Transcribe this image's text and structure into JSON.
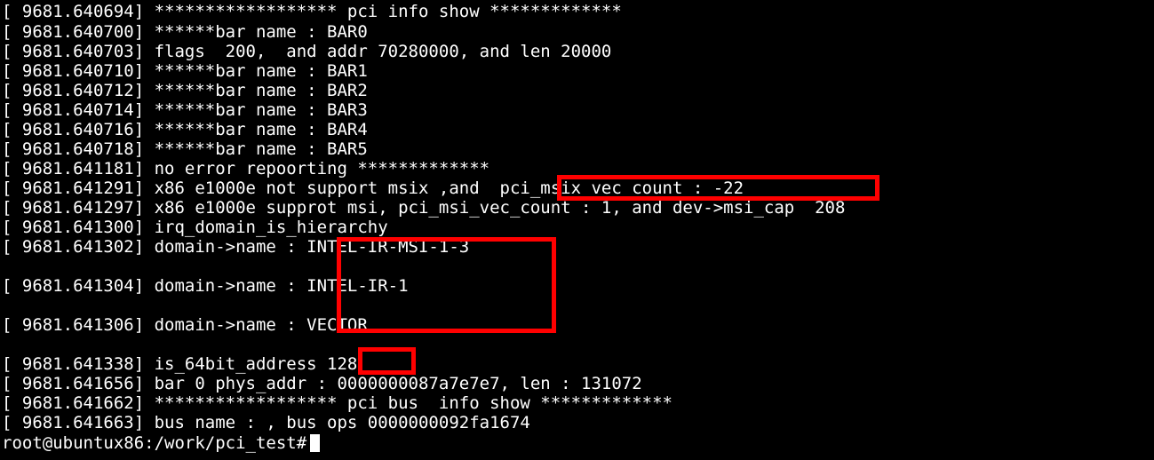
{
  "terminal": {
    "lines": [
      "[ 9681.640694] ****************** pci info show *************",
      "[ 9681.640700] ******bar name : BAR0",
      "[ 9681.640703] flags  200,  and addr 70280000, and len 20000",
      "[ 9681.640710] ******bar name : BAR1",
      "[ 9681.640712] ******bar name : BAR2",
      "[ 9681.640714] ******bar name : BAR3",
      "[ 9681.640716] ******bar name : BAR4",
      "[ 9681.640718] ******bar name : BAR5",
      "[ 9681.641181] no error repoorting *************",
      "[ 9681.641291] x86 e1000e not support msix ,and  pci_msix_vec_count : -22",
      "[ 9681.641297] x86 e1000e supprot msi, pci_msi_vec_count : 1, and dev->msi_cap  208",
      "[ 9681.641300] irq_domain_is_hierarchy",
      "[ 9681.641302] domain->name : INTEL-IR-MSI-1-3",
      "[ 9681.641304] domain->name : INTEL-IR-1",
      "[ 9681.641306] domain->name : VECTOR",
      "[ 9681.641338] is_64bit_address 128",
      "[ 9681.641656] bar 0 phys_addr : 0000000087a7e7e7, len : 131072",
      "[ 9681.641662] ****************** pci bus  info show *************",
      "[ 9681.641663] bus name : , bus ops 0000000092fa1674"
    ],
    "prompt": "root@ubuntux86:/work/pci_test#",
    "colors": {
      "background": "#000000",
      "text": "#ffffff",
      "highlight": "#ff0000"
    }
  }
}
